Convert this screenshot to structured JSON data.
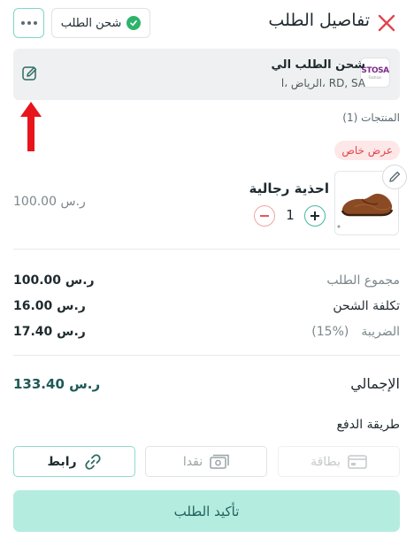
{
  "header": {
    "title": "تفاصيل الطلب",
    "status_badge": "شحن الطلب"
  },
  "address": {
    "name": "شحن الطلب الي",
    "line": "RD, SA ،الرياض ،l",
    "store_logo_text": "STOSA",
    "store_logo_sub": "Fashion"
  },
  "products": {
    "label": "المنتجات (1)",
    "offer_badge": "عرض خاص",
    "items": [
      {
        "name": "احذية رجالية",
        "quantity": "1",
        "price": "100.00 ر.س"
      }
    ]
  },
  "summary": {
    "subtotal_label": "مجموع الطلب",
    "subtotal_value": "100.00 ر.س",
    "shipping_label": "تكلفة الشحن",
    "shipping_value": "16.00 ر.س",
    "tax_label": "الضريبة",
    "tax_rate": "(15%)",
    "tax_value": "17.40 ر.س",
    "total_label": "الإجمالي",
    "total_value": "133.40 ر.س"
  },
  "payment": {
    "title": "طريقة الدفع",
    "options": [
      {
        "label": "بطاقة",
        "icon": "credit-card-icon",
        "state": "disabled"
      },
      {
        "label": "نقدا",
        "icon": "cash-icon",
        "state": "enabled"
      },
      {
        "label": "رابط",
        "icon": "link-icon",
        "state": "selected"
      }
    ]
  },
  "confirm_label": "تأكيد الطلب",
  "colors": {
    "accent": "#8edbcc",
    "confirm_bg": "#b5ece0",
    "close": "#e2454f",
    "offer_text": "#e2454f",
    "arrow": "#e8141c"
  }
}
